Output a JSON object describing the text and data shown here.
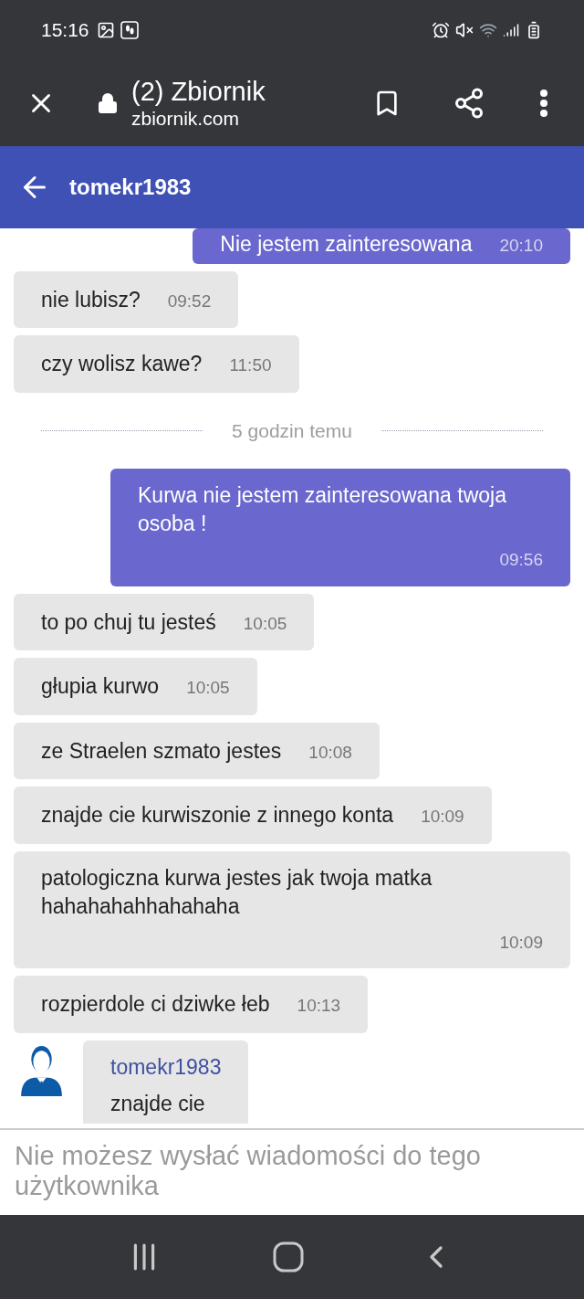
{
  "status_bar": {
    "time": "15:16"
  },
  "browser": {
    "page_title": "(2) Zbiornik",
    "url": "zbiornik.com"
  },
  "header": {
    "title": "tomekr1983"
  },
  "messages": [
    {
      "kind": "sent",
      "text": "Nie jestem zainteresowana",
      "time": "20:10"
    },
    {
      "kind": "received",
      "text": "nie lubisz?",
      "time": "09:52"
    },
    {
      "kind": "received",
      "text": "czy wolisz kawe?",
      "time": "11:50"
    },
    {
      "kind": "divider",
      "text": "5 godzin temu"
    },
    {
      "kind": "sent",
      "text": "Kurwa nie jestem zainteresowana twoja osoba !",
      "time": "09:56"
    },
    {
      "kind": "received",
      "text": "to po chuj tu jesteś",
      "time": "10:05"
    },
    {
      "kind": "received",
      "text": "głupia kurwo",
      "time": "10:05"
    },
    {
      "kind": "received",
      "text": "ze Straelen szmato jestes",
      "time": "10:08"
    },
    {
      "kind": "received",
      "text": "znajde cie kurwiszonie z innego konta",
      "time": "10:09"
    },
    {
      "kind": "received",
      "text": "patologiczna kurwa jestes jak twoja matka hahahahahhahahaha",
      "time": "10:09"
    },
    {
      "kind": "received",
      "text": "rozpierdole ci dziwke łeb",
      "time": "10:13"
    },
    {
      "kind": "named",
      "author": "tomekr1983",
      "text": "znajde cie"
    }
  ],
  "composer": {
    "placeholder": "Nie możesz wysłać wiadomości do tego użytkownika"
  }
}
